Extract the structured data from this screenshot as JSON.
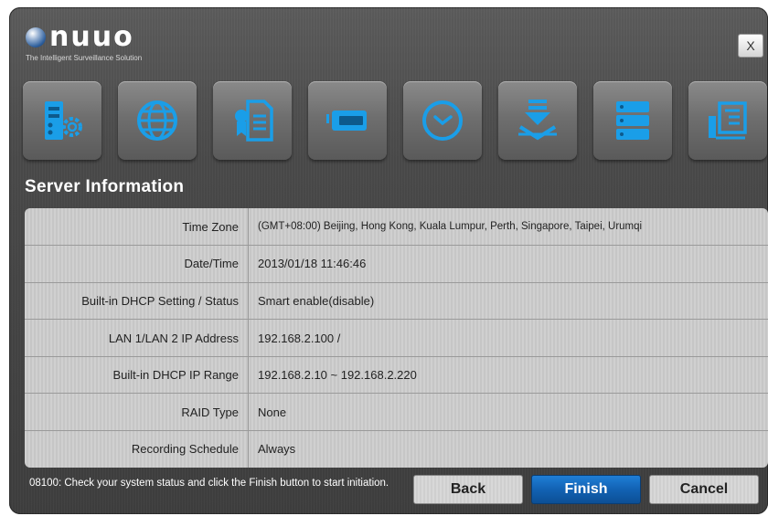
{
  "header": {
    "logo_text": "nuuo",
    "tagline": "The Intelligent Surveillance Solution",
    "close_label": "X"
  },
  "toolbar": {
    "icons": [
      {
        "name": "server-settings-icon"
      },
      {
        "name": "network-globe-icon"
      },
      {
        "name": "license-certificate-icon"
      },
      {
        "name": "storage-drive-icon"
      },
      {
        "name": "clock-icon"
      },
      {
        "name": "download-install-icon"
      },
      {
        "name": "raid-stack-icon"
      },
      {
        "name": "settings-document-icon"
      }
    ]
  },
  "section_title": "Server Information",
  "info": {
    "rows": [
      {
        "label": "Time Zone",
        "value": "(GMT+08:00) Beijing, Hong Kong, Kuala Lumpur, Perth, Singapore, Taipei, Urumqi"
      },
      {
        "label": "Date/Time",
        "value": "2013/01/18 11:46:46"
      },
      {
        "label": "Built-in DHCP Setting / Status",
        "value": "Smart enable(disable)"
      },
      {
        "label": "LAN 1/LAN 2 IP Address",
        "value": "192.168.2.100 /"
      },
      {
        "label": "Built-in DHCP IP Range",
        "value": "192.168.2.10 ~ 192.168.2.220"
      },
      {
        "label": "RAID Type",
        "value": "None"
      },
      {
        "label": "Recording Schedule",
        "value": "Always"
      }
    ]
  },
  "footer": {
    "message": "08100: Check your system status and click the Finish button to start initiation.",
    "back_label": "Back",
    "finish_label": "Finish",
    "cancel_label": "Cancel"
  },
  "colors": {
    "accent_blue": "#1a9ee8",
    "finish_button": "#1262b3",
    "panel_bg": "#4a4a4a"
  }
}
